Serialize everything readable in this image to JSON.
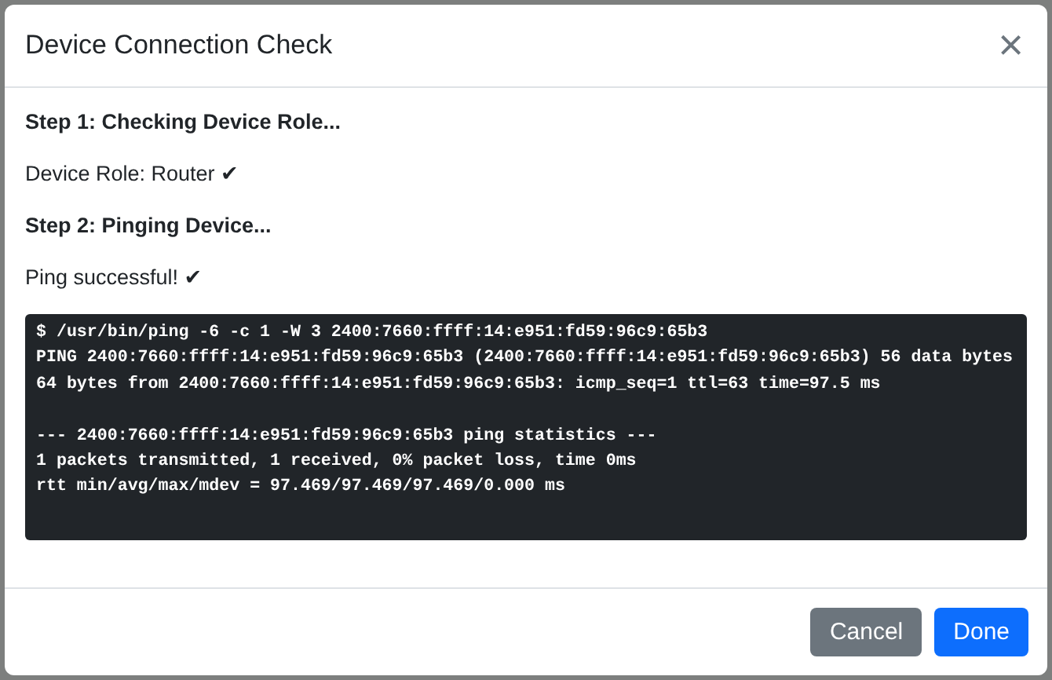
{
  "dialog": {
    "title": "Device Connection Check",
    "close_glyph": "×"
  },
  "steps": [
    {
      "kind": "heading",
      "text": "Step 1: Checking Device Role..."
    },
    {
      "kind": "result",
      "text": "Device Role: Router",
      "mark": "✔"
    },
    {
      "kind": "heading",
      "text": "Step 2: Pinging Device..."
    },
    {
      "kind": "result",
      "text": "Ping successful!",
      "mark": "✔"
    }
  ],
  "terminal_blocks": [
    [
      "$ /usr/bin/ping -6 -c 1 -W 3 2400:7660:ffff:14:e951:fd59:96c9:65b3",
      "PING 2400:7660:ffff:14:e951:fd59:96c9:65b3 (2400:7660:ffff:14:e951:fd59:96c9:65b3) 56 data bytes",
      "64 bytes from 2400:7660:ffff:14:e951:fd59:96c9:65b3: icmp_seq=1 ttl=63 time=97.5 ms"
    ],
    [
      "--- 2400:7660:ffff:14:e951:fd59:96c9:65b3 ping statistics ---",
      "1 packets transmitted, 1 received, 0% packet loss, time 0ms",
      "rtt min/avg/max/mdev = 97.469/97.469/97.469/0.000 ms"
    ]
  ],
  "buttons": [
    {
      "kind": "secondary",
      "label": "Cancel"
    },
    {
      "kind": "primary",
      "label": "Done"
    }
  ]
}
